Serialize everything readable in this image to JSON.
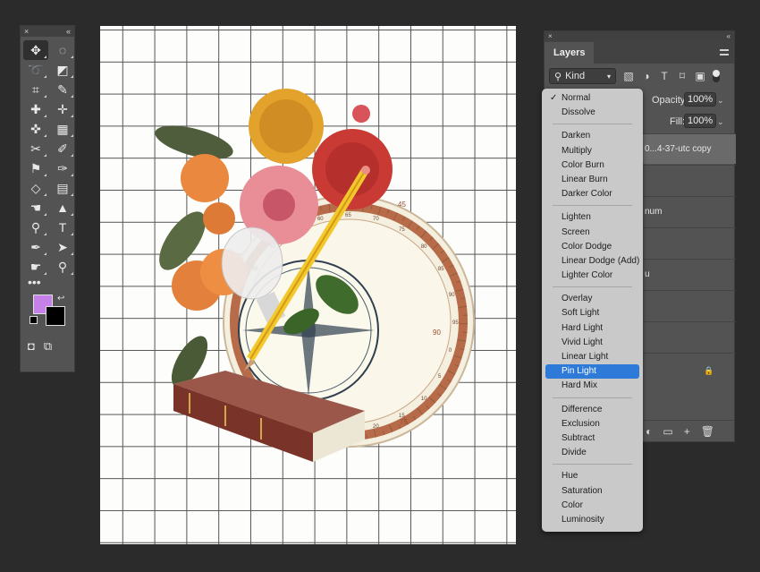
{
  "tools_panel": {
    "close_glyph": "×",
    "collapse_glyph": "«",
    "tools": [
      {
        "name": "move-tool",
        "glyph": "✥"
      },
      {
        "name": "marquee-tool",
        "glyph": "◌"
      },
      {
        "name": "lasso-tool",
        "glyph": "➰"
      },
      {
        "name": "object-select-tool",
        "glyph": "◩"
      },
      {
        "name": "crop-tool",
        "glyph": "⌗"
      },
      {
        "name": "eyedropper-tool",
        "glyph": "✎"
      },
      {
        "name": "healing-brush-tool",
        "glyph": "✚"
      },
      {
        "name": "content-aware-tool",
        "glyph": "✛"
      },
      {
        "name": "bandage-tool",
        "glyph": "✜"
      },
      {
        "name": "frame-tool",
        "glyph": "▦"
      },
      {
        "name": "puppet-warp-tool",
        "glyph": "✂"
      },
      {
        "name": "brush-tool",
        "glyph": "✐"
      },
      {
        "name": "stamp-tool",
        "glyph": "⚑"
      },
      {
        "name": "history-brush-tool",
        "glyph": "✑"
      },
      {
        "name": "eraser-tool",
        "glyph": "◇"
      },
      {
        "name": "gradient-tool",
        "glyph": "▤"
      },
      {
        "name": "smudge-tool",
        "glyph": "☚"
      },
      {
        "name": "triangle-tool",
        "glyph": "▲"
      },
      {
        "name": "dodge-tool",
        "glyph": "⚲"
      },
      {
        "name": "type-tool",
        "glyph": "T"
      },
      {
        "name": "pen-tool",
        "glyph": "✒"
      },
      {
        "name": "path-select-tool",
        "glyph": "➤"
      },
      {
        "name": "hand-tool",
        "glyph": "☛"
      },
      {
        "name": "zoom-tool",
        "glyph": "⚲"
      }
    ],
    "more_glyph": "•••",
    "foreground_color": "#c681e9",
    "background_color": "#000000",
    "swap_glyph": "↩",
    "quickmask_glyph": "◘",
    "screenmode_glyph": "⧉"
  },
  "layers_panel": {
    "close_glyph": "×",
    "collapse_glyph": "«",
    "tab_label": "Layers",
    "filter_label": "Kind",
    "filter_icons": [
      "image-filter-icon",
      "adjustment-filter-icon",
      "type-filter-icon",
      "shape-filter-icon",
      "smart-filter-icon"
    ],
    "filter_glyphs": [
      "▧",
      "◑",
      "T",
      "⌑",
      "▣"
    ],
    "opacity_label": "Opacity:",
    "opacity_value": "100%",
    "fill_label": "Fill:",
    "fill_value": "100%",
    "layer_names": [
      "0...4-37-utc copy",
      "num",
      "u"
    ],
    "lock_glyph": "🔒",
    "bottom_icons": [
      "◐",
      "▭",
      "+",
      "🗑"
    ]
  },
  "blend_menu": {
    "groups": [
      [
        "Normal",
        "Dissolve"
      ],
      [
        "Darken",
        "Multiply",
        "Color Burn",
        "Linear Burn",
        "Darker Color"
      ],
      [
        "Lighten",
        "Screen",
        "Color Dodge",
        "Linear Dodge (Add)",
        "Lighter Color"
      ],
      [
        "Overlay",
        "Soft Light",
        "Hard Light",
        "Vivid Light",
        "Linear Light",
        "Pin Light",
        "Hard Mix"
      ],
      [
        "Difference",
        "Exclusion",
        "Subtract",
        "Divide"
      ],
      [
        "Hue",
        "Saturation",
        "Color",
        "Luminosity"
      ]
    ],
    "checked": "Normal",
    "highlighted": "Pin Light",
    "highlight_color": "#2d7ad9"
  },
  "artwork": {
    "compass_ticks": [
      "45",
      "90",
      "75"
    ],
    "scale_labels": [
      "45",
      "50",
      "55",
      "60",
      "65",
      "70",
      "75",
      "80",
      "85",
      "90",
      "95",
      "0",
      "5",
      "10",
      "15",
      "20",
      "25",
      "30",
      "35",
      "40"
    ]
  }
}
